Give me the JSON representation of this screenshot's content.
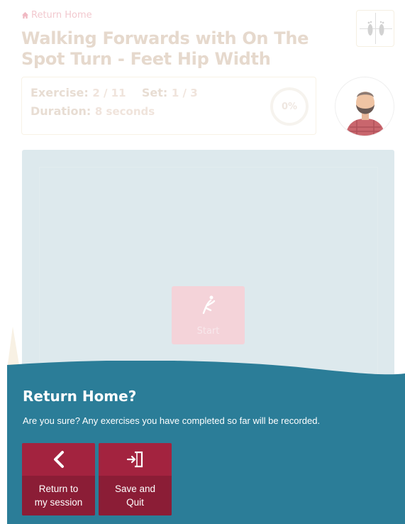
{
  "nav": {
    "home_label": "Return Home"
  },
  "exercise": {
    "title": "Walking Forwards with On The Spot Turn - Feet Hip Width",
    "exercise_label": "Exercise:",
    "exercise_value": "2 / 11",
    "set_label": "Set:",
    "set_value": "1 / 3",
    "duration_label": "Duration:",
    "duration_value": "8 seconds",
    "progress_text": "0%",
    "progress_value": 0
  },
  "player": {
    "start_label": "Start"
  },
  "modal": {
    "title": "Return Home?",
    "message": "Are you sure? Any exercises you have completed so far will be recorded.",
    "return_label": "Return to\nmy session",
    "save_label": "Save and\nQuit"
  },
  "colors": {
    "modal_bg": "#2b7d98",
    "button_top": "#a3233f",
    "button_bottom": "#8b1d36",
    "video_bg": "#dde9ed"
  },
  "icons": {
    "home": "home-icon",
    "feet": "feet-icon",
    "start": "stretch-figure-icon",
    "back": "chevron-left-icon",
    "exit": "door-exit-icon"
  }
}
